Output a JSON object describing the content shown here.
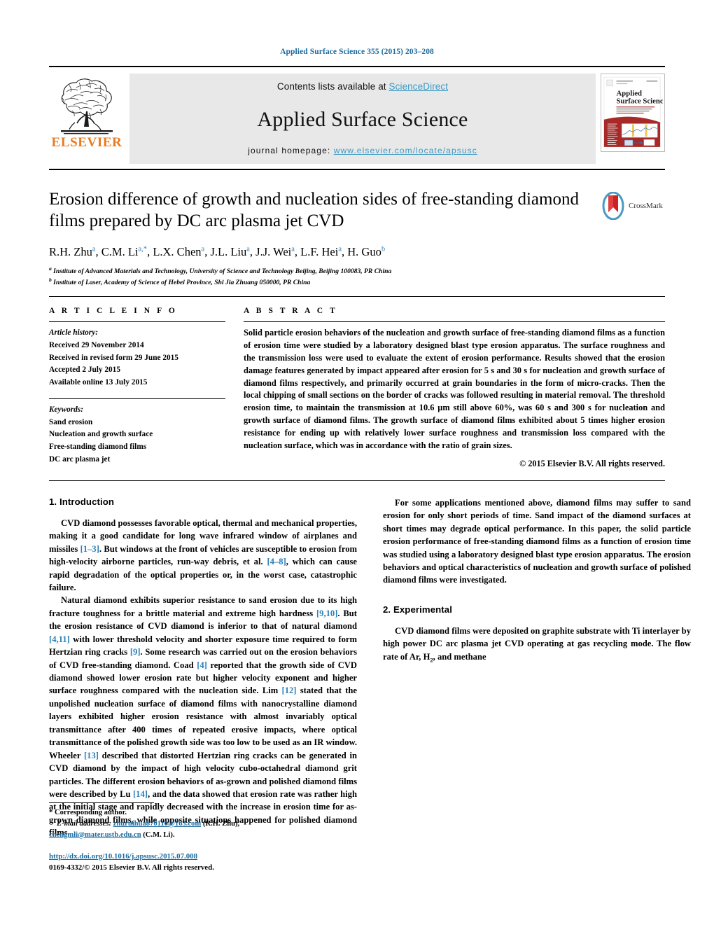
{
  "running_head": "Applied Surface Science 355 (2015) 203–208",
  "masthead": {
    "publisher_name": "ELSEVIER",
    "contents_prefix": "Contents lists available at ",
    "contents_link": "ScienceDirect",
    "journal_title": "Applied Surface Science",
    "homepage_prefix": "journal homepage: ",
    "homepage_url": "www.elsevier.com/locate/apsusc",
    "cover_title_line1": "Applied",
    "cover_title_line2": "Surface Science"
  },
  "article": {
    "title": "Erosion difference of growth and nucleation sides of free-standing diamond films prepared by DC arc plasma jet CVD",
    "crossmark_label": "CrossMark",
    "authors_html": "R.H. Zhu<sup>a</sup>, C.M. Li<sup>a,*</sup>, L.X. Chen<sup>a</sup>, J.L. Liu<sup>a</sup>, J.J. Wei<sup>a</sup>, L.F. Hei<sup>a</sup>, H. Guo<sup>b</sup>",
    "affiliations": [
      "Institute of Advanced Materials and Technology, University of Science and Technology Beijing, Beijing 100083, PR China",
      "Institute of Laser, Academy of Science of Hebei Province, Shi Jia Zhuang 050000, PR China"
    ]
  },
  "article_info": {
    "heading": "A R T I C L E   I N F O",
    "history_title": "Article history:",
    "history": [
      "Received 29 November 2014",
      "Received in revised form 29 June 2015",
      "Accepted 2 July 2015",
      "Available online 13 July 2015"
    ],
    "keywords_title": "Keywords:",
    "keywords": [
      "Sand erosion",
      "Nucleation and growth surface",
      "Free-standing diamond films",
      "DC arc plasma jet"
    ]
  },
  "abstract": {
    "heading": "A B S T R A C T",
    "text": "Solid particle erosion behaviors of the nucleation and growth surface of free-standing diamond films as a function of erosion time were studied by a laboratory designed blast type erosion apparatus. The surface roughness and the transmission loss were used to evaluate the extent of erosion performance. Results showed that the erosion damage features generated by impact appeared after erosion for 5 s and 30 s for nucleation and growth surface of diamond films respectively, and primarily occurred at grain boundaries in the form of micro-cracks. Then the local chipping of small sections on the border of cracks was followed resulting in material removal. The threshold erosion time, to maintain the transmission at 10.6 μm still above 60%, was 60 s and 300 s for nucleation and growth surface of diamond films. The growth surface of diamond films exhibited about 5 times higher erosion resistance for ending up with relatively lower surface roughness and transmission loss compared with the nucleation surface, which was in accordance with the ratio of grain sizes.",
    "copyright": "© 2015 Elsevier B.V. All rights reserved."
  },
  "sections": {
    "introduction_heading": "1.  Introduction",
    "experimental_heading": "2.  Experimental",
    "intro_p1_a": "CVD diamond possesses favorable optical, thermal and mechanical properties, making it a good candidate for long wave infrared window of airplanes and missiles ",
    "intro_p1_ref1": "[1–3]",
    "intro_p1_b": ". But windows at the front of vehicles are susceptible to erosion from high-velocity airborne particles, run-way debris, et al. ",
    "intro_p1_ref2": "[4–8]",
    "intro_p1_c": ", which can cause rapid degradation of the optical properties or, in the worst case, catastrophic failure.",
    "intro_p2_a": "Natural diamond exhibits superior resistance to sand erosion due to its high fracture toughness for a brittle material and extreme high hardness ",
    "intro_p2_ref1": "[9,10]",
    "intro_p2_b": ". But the erosion resistance of CVD diamond is inferior to that of natural diamond ",
    "intro_p2_ref2": "[4,11]",
    "intro_p2_c": " with lower threshold velocity and shorter exposure time required to form Hertzian ring cracks ",
    "intro_p2_ref3": "[9]",
    "intro_p2_d": ". Some research was carried out on the erosion behaviors of CVD free-standing diamond. Coad ",
    "intro_p2_ref4": "[4]",
    "intro_p2_e": " reported that the growth side of CVD diamond showed lower erosion rate but higher velocity exponent and higher surface roughness compared with the nucleation side. Lim ",
    "intro_p2_ref5": "[12]",
    "intro_p2_f": " stated that the unpolished nucleation surface of diamond films with nanocrystalline diamond layers exhibited higher erosion resistance with almost invariably optical transmittance after 400 times of repeated erosive impacts, where optical transmittance of the polished growth side was too low to be used as an IR window. Wheeler ",
    "intro_p2_ref6": "[13]",
    "intro_p2_g": " described that distorted Hertzian ring cracks can be generated in CVD diamond by the impact of high velocity cubo-octahedral diamond grit particles. The different erosion behaviors of as-grown and polished diamond films were described by Lu ",
    "intro_p2_ref7": "[14]",
    "intro_p2_h": ", and the data showed that erosion rate was rather high at the initial stage and rapidly decreased with the increase in erosion time for as-grown diamond films, while opposite situations happened for polished diamond films.",
    "intro_p3": "For some applications mentioned above, diamond films may suffer to sand erosion for only short periods of time. Sand impact of the diamond surfaces at short times may degrade optical performance. In this paper, the solid particle erosion performance of free-standing diamond films as a function of erosion time was studied using a laboratory designed blast type erosion apparatus. The erosion behaviors and optical characteristics of nucleation and growth surface of polished diamond films were investigated.",
    "exp_p1_a": "CVD diamond films were deposited on graphite substrate with Ti interlayer by high power DC arc plasma jet CVD operating at gas recycling mode. The flow rate of Ar, H",
    "exp_p1_sub": "2",
    "exp_p1_b": ", and methane"
  },
  "footnote": {
    "corresponding": "*  Corresponding author.",
    "email_label": "E-mail addresses:",
    "email1": "zhuruihua870116@163.com",
    "email1_owner": " (R.H. Zhu),",
    "email2": "chengmli@mater.ustb.edu.cn",
    "email2_owner": " (C.M. Li).",
    "doi": "http://dx.doi.org/10.1016/j.apsusc.2015.07.008",
    "issn_line": "0169-4332/© 2015 Elsevier B.V. All rights reserved."
  },
  "colors": {
    "link_blue": "#1a6a9e",
    "ref_blue": "#2b7fb8",
    "sd_blue": "#3d9ac4",
    "elsevier_orange": "#e87a1e",
    "mast_bg": "#e8e8e8"
  }
}
